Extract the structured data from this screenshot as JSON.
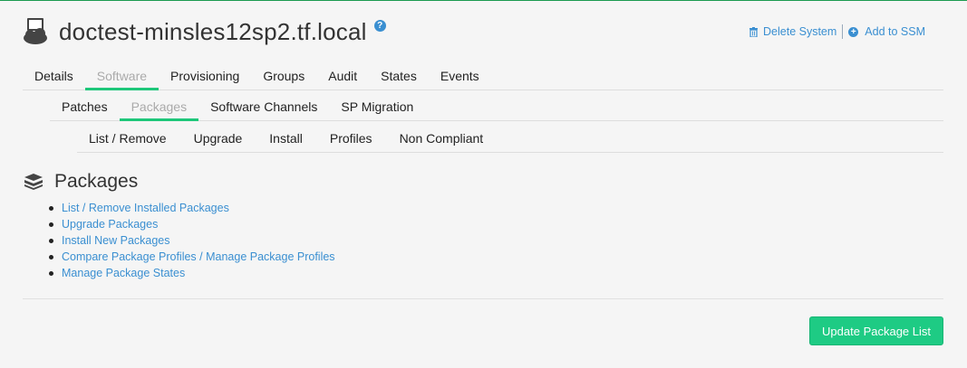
{
  "header": {
    "title": "doctest-minsles12sp2.tf.local",
    "help": "?"
  },
  "actions": {
    "delete_label": "Delete System",
    "add_ssm_label": "Add to SSM"
  },
  "tabs": [
    "Details",
    "Software",
    "Provisioning",
    "Groups",
    "Audit",
    "States",
    "Events"
  ],
  "active_tab": "Software",
  "subtabs": [
    "Patches",
    "Packages",
    "Software Channels",
    "SP Migration"
  ],
  "active_subtab": "Packages",
  "subsubtabs": [
    "List / Remove",
    "Upgrade",
    "Install",
    "Profiles",
    "Non Compliant"
  ],
  "section": {
    "title": "Packages",
    "links": [
      "List / Remove Installed Packages",
      "Upgrade Packages",
      "Install New Packages",
      "Compare Package Profiles / Manage Package Profiles",
      "Manage Package States"
    ]
  },
  "button": {
    "update_label": "Update Package List"
  },
  "colors": {
    "accent": "#1ec77a",
    "link": "#3a8fd1",
    "button": "#1ecb84"
  }
}
